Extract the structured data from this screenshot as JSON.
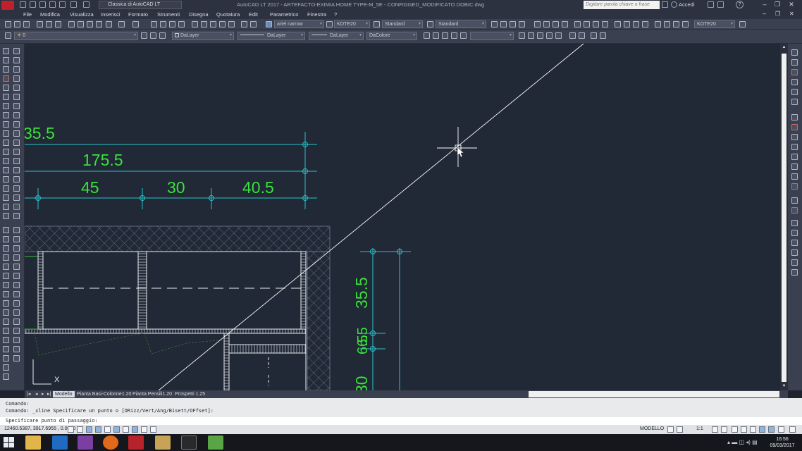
{
  "titlebar": {
    "workspace": "Classica di AutoCAD LT",
    "window_title": "AutoCAD LT 2017 - ARTEFACTO-EXIMIA HOME TYPE-M_5E - CONFIGGED_MODIFICATO DOBIC.dwg",
    "search_placeholder": "Digitare parola chiave o frase",
    "signin": "Accedi",
    "help": "?"
  },
  "menu": [
    "File",
    "Modifica",
    "Visualizza",
    "Inserisci",
    "Formato",
    "Strumenti",
    "Disegna",
    "Quotatura",
    "Edit",
    "Parametrico",
    "Finestra",
    "?"
  ],
  "toolbar2": {
    "text_font": "ariel narrow",
    "dim_style": "KOTE20",
    "text_style": "Standard",
    "table_style": "Standard",
    "dim_style_right": "KOTE20"
  },
  "toolbar3": {
    "layer": "0",
    "color": "DaLayer",
    "linetype": "DaLayer",
    "lineweight": "DaLayer",
    "plotstyle": "DaColore"
  },
  "drawing": {
    "dims_top": {
      "d1": "35.5",
      "d2": "175.5",
      "d3": "45",
      "d4": "30",
      "d5": "40.5"
    },
    "dims_right": {
      "v1": "35.5",
      "v2": "6.5",
      "v3": "6.5",
      "v4": "30"
    },
    "ucs_x_label": "X",
    "colors": {
      "background": "#212836",
      "dim_line": "#28c3c9",
      "dim_text": "#39e23a",
      "geometry": "#e9ecf0",
      "hatch": "#6f7a8e",
      "construction_line": "#ffffff"
    }
  },
  "tabs": {
    "items": [
      "Modello",
      "Pianta Basi-Colonne1.20",
      "Pianta Pensili1.20",
      "Prospetti 1.25"
    ],
    "active": "Modello"
  },
  "command": {
    "history": [
      "Comando:",
      "Comando: _xline Specificare un punto o [ORizz/Vert/Ang/Bisett/OFfset]:"
    ],
    "prompt": "Specificare punto di passaggio:"
  },
  "status": {
    "coordinates": "12460.5387, 3917.6955 , 0.0000",
    "model": "MODELLO",
    "scale": "1:1"
  },
  "clock": {
    "time": "16:56",
    "date": "09/03/2017"
  }
}
